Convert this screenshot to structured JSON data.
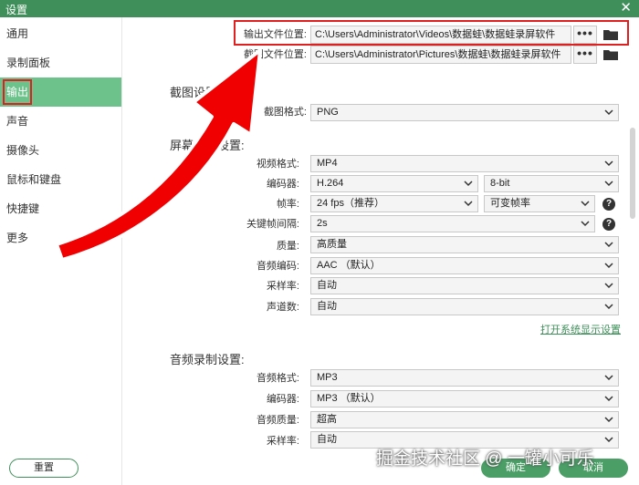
{
  "window": {
    "title": "设置"
  },
  "sidebar": {
    "items": [
      {
        "label": "通用"
      },
      {
        "label": "录制面板"
      },
      {
        "label": "输出"
      },
      {
        "label": "声音"
      },
      {
        "label": "摄像头"
      },
      {
        "label": "鼠标和键盘"
      },
      {
        "label": "快捷键"
      },
      {
        "label": "更多"
      }
    ],
    "active_index": 2,
    "reset_label": "重置"
  },
  "paths": {
    "output": {
      "label": "输出文件位置:",
      "value": "C:\\Users\\Administrator\\Videos\\数据蛙\\数据蛙录屏软件"
    },
    "screenshot": {
      "label": "截图文件位置:",
      "value": "C:\\Users\\Administrator\\Pictures\\数据蛙\\数据蛙录屏软件"
    },
    "dots": "•••"
  },
  "screenshot_settings": {
    "title": "截图设置",
    "format_label": "截图格式:",
    "format_value": "PNG"
  },
  "screen_recording": {
    "title": "屏幕录制设置:",
    "fields": [
      {
        "label": "视频格式:",
        "value": "MP4"
      },
      {
        "label": "编码器:",
        "value": "H.264",
        "value2": "8-bit"
      },
      {
        "label": "帧率:",
        "value": "24 fps（推荐）",
        "value2": "可变帧率"
      },
      {
        "label": "关键帧间隔:",
        "value": "2s"
      },
      {
        "label": "质量:",
        "value": "高质量"
      },
      {
        "label": "音频编码:",
        "value": "AAC （默认）"
      },
      {
        "label": "采样率:",
        "value": "自动"
      },
      {
        "label": "声道数:",
        "value": "自动"
      }
    ],
    "display_link": "打开系统显示设置"
  },
  "audio_recording": {
    "title": "音频录制设置:",
    "fields": [
      {
        "label": "音频格式:",
        "value": "MP3"
      },
      {
        "label": "编码器:",
        "value": "MP3 （默认）"
      },
      {
        "label": "音频质量:",
        "value": "超高"
      },
      {
        "label": "采样率:",
        "value": "自动"
      }
    ]
  },
  "footer": {
    "ok_label": "确定",
    "cancel_label": "取消"
  },
  "help_glyph": "?",
  "watermark": "掘金技术社区 @ 一罐小可乐",
  "colors": {
    "accent": "#3f8f5a",
    "active": "#6cc28a",
    "annotation": "#e02020"
  }
}
